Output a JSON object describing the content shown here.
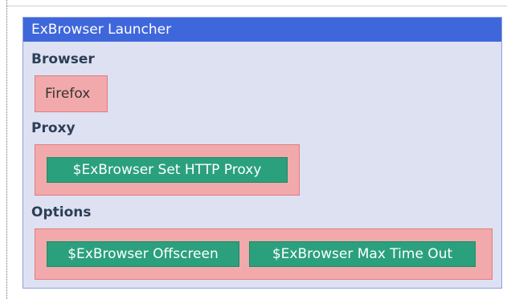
{
  "launcher": {
    "title": "ExBrowser Launcher",
    "browser_section": {
      "label": "Browser",
      "value": "Firefox"
    },
    "proxy_section": {
      "label": "Proxy",
      "buttons": [
        "$ExBrowser Set HTTP Proxy"
      ]
    },
    "options_section": {
      "label": "Options",
      "buttons": [
        "$ExBrowser Offscreen",
        "$ExBrowser Max Time Out"
      ]
    }
  },
  "colors": {
    "header_bg": "#3f67dc",
    "panel_bg": "#dde1f2",
    "group_bg": "#f2a9ab",
    "button_bg": "#2ba07c"
  }
}
